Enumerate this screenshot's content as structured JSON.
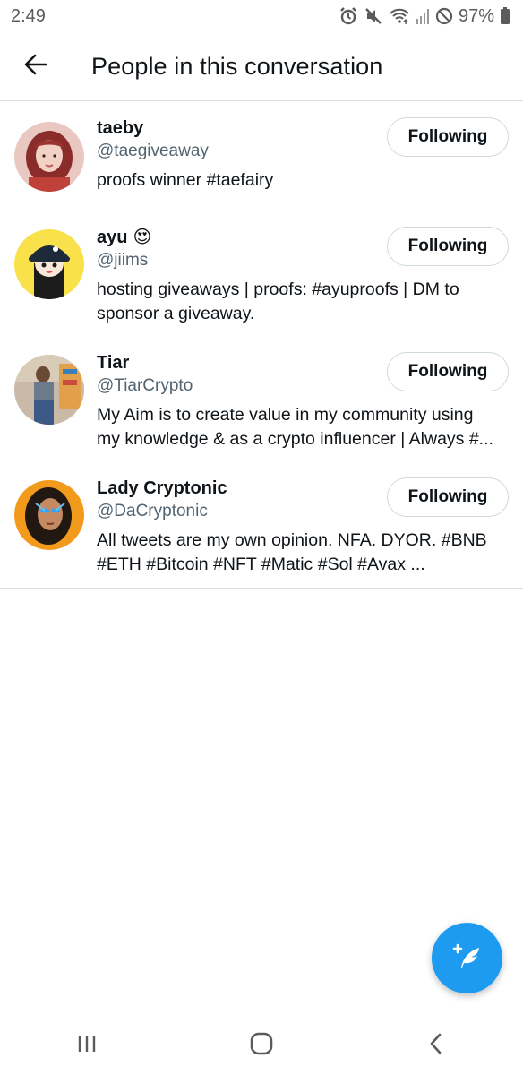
{
  "status_bar": {
    "time": "2:49",
    "battery_percent": "97%",
    "icons": [
      "alarm-icon",
      "mute-icon",
      "wifi-icon",
      "signal-icon",
      "do-not-disturb-icon",
      "battery-icon"
    ]
  },
  "header": {
    "back_icon": "arrow-left-icon",
    "title": "People in this conversation"
  },
  "people": [
    {
      "name": "taeby",
      "emoji": "",
      "handle": "@taegiveaway",
      "bio": "proofs winner #taefairy",
      "button_label": "Following"
    },
    {
      "name": "ayu",
      "emoji": "😍",
      "handle": "@jiims",
      "bio": "hosting giveaways | proofs: #ayuproofs | DM to sponsor a giveaway.",
      "button_label": "Following"
    },
    {
      "name": "Tiar",
      "emoji": "",
      "handle": "@TiarCrypto",
      "bio": "My Aim is to create value in my community using my knowledge & as a crypto influencer | Always #...",
      "button_label": "Following"
    },
    {
      "name": "Lady Cryptonic",
      "emoji": "",
      "handle": "@DaCryptonic",
      "bio": "All tweets are my own opinion. NFA. DYOR.  #BNB #ETH #Bitcoin #NFT #Matic #Sol #Avax ...",
      "button_label": "Following"
    }
  ],
  "fab": {
    "icon": "compose-tweet-icon"
  },
  "nav_bar": {
    "icons": [
      "recent-apps-icon",
      "home-icon",
      "back-icon"
    ]
  },
  "colors": {
    "accent": "#1d9bf0",
    "text": "#0f1419",
    "secondary": "#536471",
    "border": "#cfd9de"
  }
}
